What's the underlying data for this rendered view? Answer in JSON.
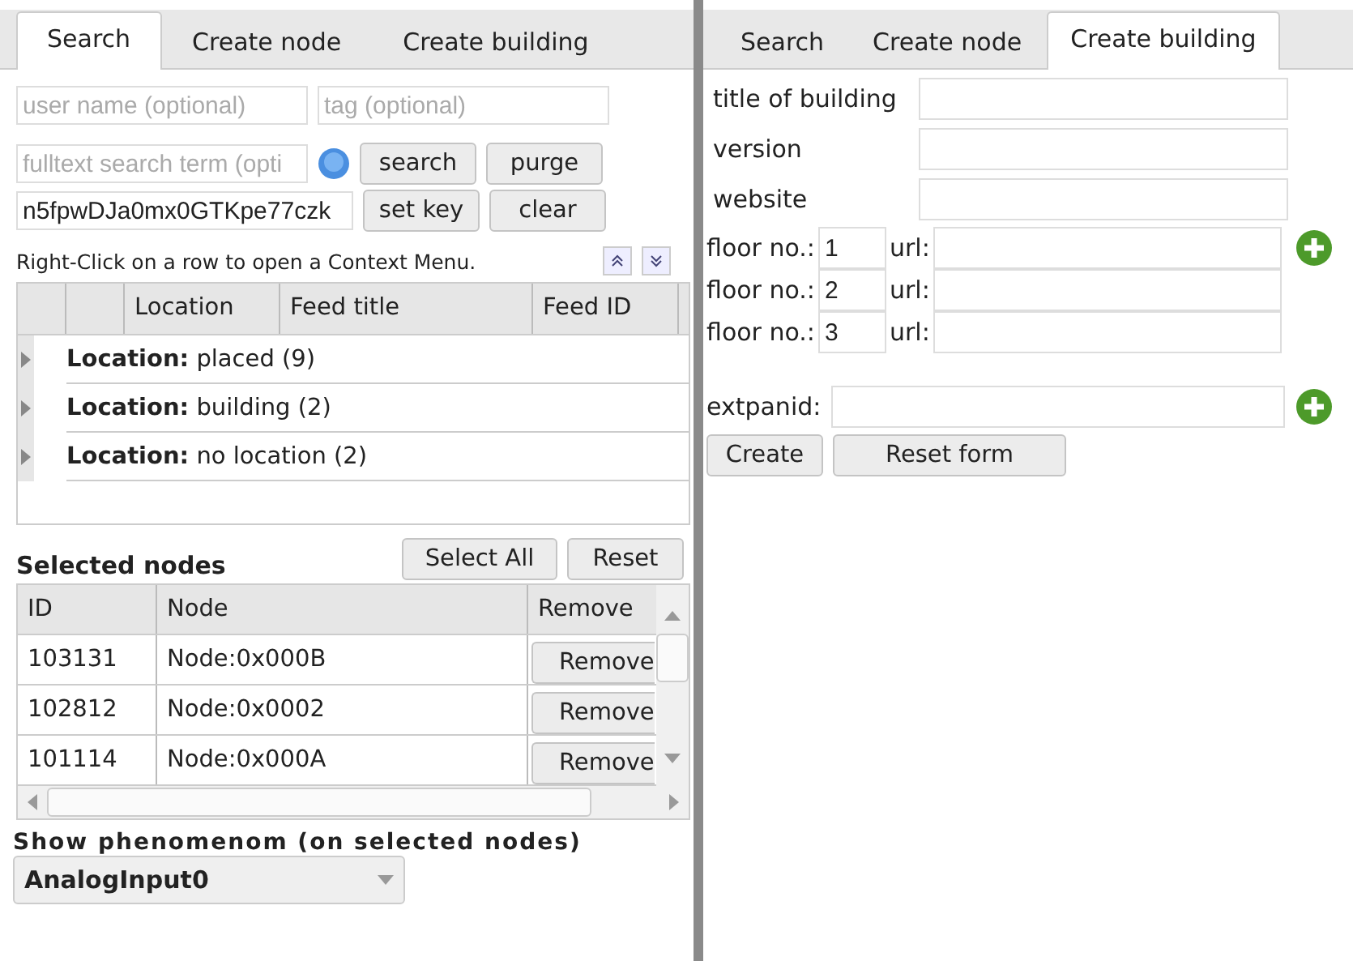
{
  "left": {
    "tabs": [
      {
        "label": "Search",
        "selected": true
      },
      {
        "label": "Create node",
        "selected": false
      },
      {
        "label": "Create building",
        "selected": false
      }
    ],
    "search_form": {
      "user_name": {
        "placeholder": "user name (optional)"
      },
      "tag": {
        "placeholder": "tag (optional)"
      },
      "fulltext": {
        "placeholder": "fulltext search term (opti"
      },
      "key": {
        "value": "n5fpwDJa0mx0GTKpe77czk"
      },
      "search_button": "search",
      "purge_button": "purge",
      "set_key_button": "set key",
      "clear_button": "clear"
    },
    "hint": "Right-Click on a row to open a Context Menu.",
    "grid": {
      "columns": [
        "Location",
        "Feed title",
        "Feed ID"
      ],
      "groups": [
        {
          "label": "Location:",
          "value": "placed (9)",
          "expanded": false
        },
        {
          "label": "Location:",
          "value": "building (2)",
          "expanded": false
        },
        {
          "label": "Location:",
          "value": "no location (2)",
          "expanded": false
        }
      ]
    },
    "selected_nodes": {
      "title": "Selected nodes",
      "select_all_button": "Select All",
      "reset_button": "Reset",
      "columns": [
        "ID",
        "Node",
        "Remove"
      ],
      "rows": [
        {
          "id": "103131",
          "node": "Node:0x000B",
          "action": "Remove"
        },
        {
          "id": "102812",
          "node": "Node:0x0002",
          "action": "Remove"
        },
        {
          "id": "101114",
          "node": "Node:0x000A",
          "action": "Remove"
        }
      ]
    },
    "phenomenon": {
      "label": "Show phenomenom (on selected nodes)",
      "value": "AnalogInput0"
    }
  },
  "right": {
    "tabs": [
      {
        "label": "Search",
        "selected": false
      },
      {
        "label": "Create node",
        "selected": false
      },
      {
        "label": "Create building",
        "selected": true
      }
    ],
    "fields": [
      {
        "label": "title of building"
      },
      {
        "label": "version"
      },
      {
        "label": "website"
      }
    ],
    "floors": [
      {
        "label": "floor no.:",
        "number": "1",
        "url_label": "url:",
        "add_button": true
      },
      {
        "label": "floor no.:",
        "number": "2",
        "url_label": "url:",
        "add_button": false
      },
      {
        "label": "floor no.:",
        "number": "3",
        "url_label": "url:",
        "add_button": false
      }
    ],
    "extpanid": {
      "label": "extpanid:",
      "add_button": true
    },
    "create_button": "Create",
    "reset_button": "Reset form"
  }
}
